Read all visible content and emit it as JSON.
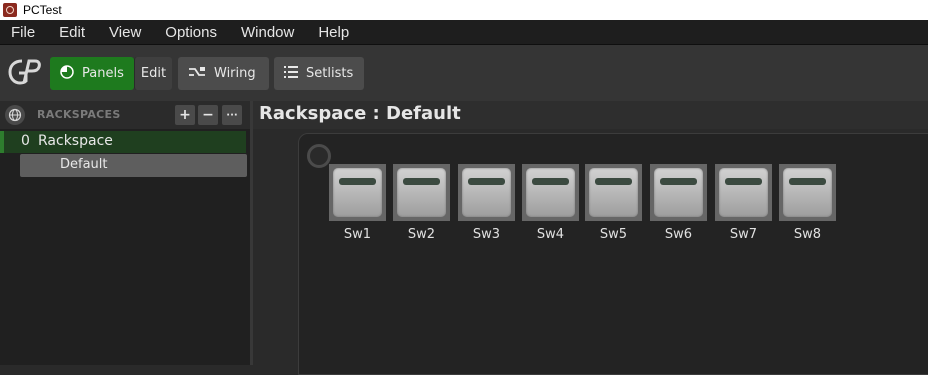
{
  "window": {
    "title": "PCTest"
  },
  "menu": {
    "items": [
      "File",
      "Edit",
      "View",
      "Options",
      "Window",
      "Help"
    ]
  },
  "toolbar": {
    "logo_icon": "gp-logo-icon",
    "panels_label": "Panels",
    "edit_label": "Edit",
    "wiring_label": "Wiring",
    "setlists_label": "Setlists"
  },
  "sidebar": {
    "header": "RACKSPACES",
    "add_label": "+",
    "remove_label": "−",
    "more_label": "···",
    "rackspace": {
      "index": "0",
      "name": "Rackspace"
    },
    "variation": {
      "name": "Default"
    }
  },
  "main": {
    "title": "Rackspace : Default",
    "switches": [
      "Sw1",
      "Sw2",
      "Sw3",
      "Sw4",
      "Sw5",
      "Sw6",
      "Sw7",
      "Sw8"
    ]
  },
  "colors": {
    "accent_green": "#1e7a1e",
    "background": "#2a2a2a"
  }
}
